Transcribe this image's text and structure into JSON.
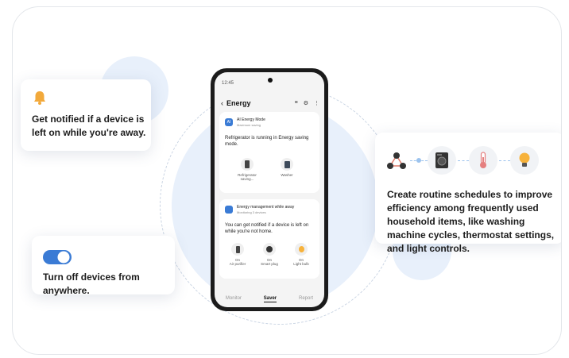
{
  "cards": {
    "notify_text": "Get notified if a device is left on while you're away.",
    "turnoff_text": "Turn off devices from anywhere.",
    "routine_text": "Create routine schedules to improve efficiency among frequently used household items, like washing machine cycles, thermostat settings, and light controls."
  },
  "phone": {
    "time": "12:45",
    "title": "Energy",
    "ai_card": {
      "title": "AI Energy Mode",
      "subtitle": "Maximum saving",
      "message": "Refrigerator is running in Energy saving mode.",
      "devices": [
        {
          "label": "Refrigerator saving..."
        },
        {
          "label": "Washer"
        }
      ]
    },
    "away_card": {
      "title": "Energy management while away",
      "subtitle": "Monitoring 3 devices",
      "message": "You can get notified if a device is left on while you're not home.",
      "devices": [
        {
          "status": "On",
          "label": "Air purifier"
        },
        {
          "status": "On",
          "label": "Smart plug"
        },
        {
          "status": "On",
          "label": "Light bulb"
        }
      ]
    },
    "nav": [
      "Monitor",
      "Saver",
      "Report"
    ]
  },
  "colors": {
    "accent": "#3a7bd5",
    "bell": "#f2a93b",
    "bg_circle": "#e6eef9"
  },
  "icons": {
    "bell": "bell-icon",
    "toggle": "toggle-icon",
    "routine": "routine-nodes-icon",
    "washer": "washer-icon",
    "thermometer": "thermometer-icon",
    "bulb": "light-bulb-icon"
  }
}
